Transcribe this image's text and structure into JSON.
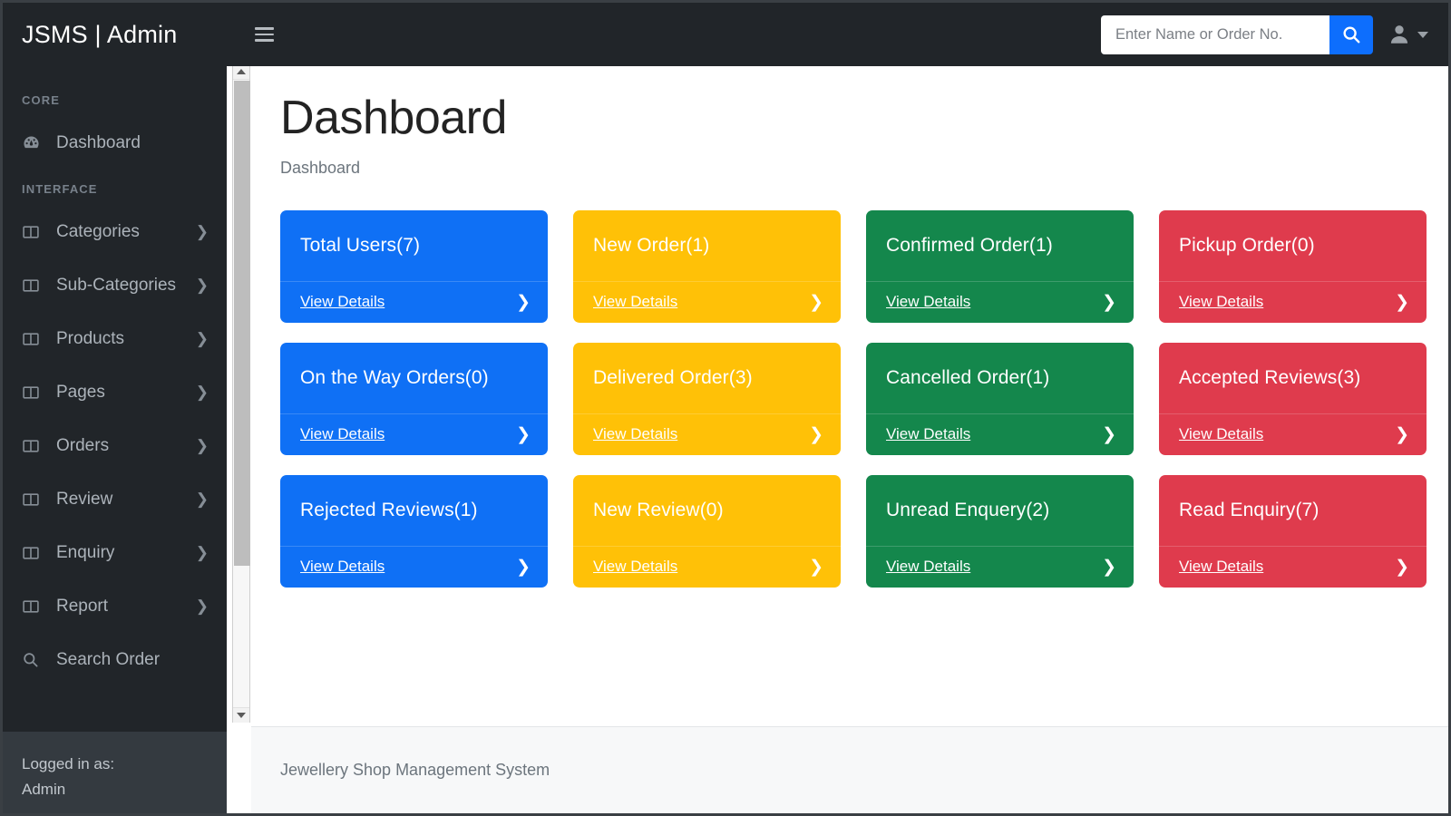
{
  "window": {
    "border_color": "#3a3f44"
  },
  "navbar": {
    "brand": "JSMS | Admin",
    "hamburger_icon": "hamburger-menu-icon",
    "search": {
      "placeholder": "Enter Name or Order No.",
      "value": "",
      "button_icon": "search-icon",
      "button_color": "#0d6efd"
    },
    "user": {
      "icon": "user-avatar-icon",
      "caret_icon": "chevron-down-icon"
    }
  },
  "sidebar": {
    "sections": [
      {
        "heading": "CORE",
        "items": [
          {
            "label": "Dashboard",
            "icon": "tachometer-icon",
            "has_chevron": false
          }
        ]
      },
      {
        "heading": "INTERFACE",
        "items": [
          {
            "label": "Categories",
            "icon": "columns-icon",
            "has_chevron": true
          },
          {
            "label": "Sub-Categories",
            "icon": "columns-icon",
            "has_chevron": true
          },
          {
            "label": "Products",
            "icon": "columns-icon",
            "has_chevron": true
          },
          {
            "label": "Pages",
            "icon": "columns-icon",
            "has_chevron": true
          },
          {
            "label": "Orders",
            "icon": "columns-icon",
            "has_chevron": true
          },
          {
            "label": "Review",
            "icon": "columns-icon",
            "has_chevron": true
          },
          {
            "label": "Enquiry",
            "icon": "columns-icon",
            "has_chevron": true
          },
          {
            "label": "Report",
            "icon": "columns-icon",
            "has_chevron": true
          },
          {
            "label": "Search Order",
            "icon": "search-icon",
            "has_chevron": false
          }
        ]
      }
    ],
    "footer": {
      "label": "Logged in as:",
      "user": "Admin"
    }
  },
  "scrollbar": {
    "up_arrow_icon": "triangle-up-icon",
    "down_arrow_icon": "triangle-down-icon"
  },
  "main": {
    "title": "Dashboard",
    "breadcrumb": "Dashboard",
    "view_details_label": "View Details",
    "chevron_icon": "chevron-right-icon",
    "cards": [
      {
        "title": "Total Users(7)",
        "color": "#0f70f5",
        "variant": "c-blue"
      },
      {
        "title": "New Order(1)",
        "color": "#ffc107",
        "variant": "c-yellow"
      },
      {
        "title": "Confirmed Order(1)",
        "color": "#14874c",
        "variant": "c-green"
      },
      {
        "title": "Pickup Order(0)",
        "color": "#df3b4d",
        "variant": "c-red"
      },
      {
        "title": "On the Way Orders(0)",
        "color": "#0f70f5",
        "variant": "c-blue"
      },
      {
        "title": "Delivered Order(3)",
        "color": "#ffc107",
        "variant": "c-yellow"
      },
      {
        "title": "Cancelled Order(1)",
        "color": "#14874c",
        "variant": "c-green"
      },
      {
        "title": "Accepted Reviews(3)",
        "color": "#df3b4d",
        "variant": "c-red"
      },
      {
        "title": "Rejected Reviews(1)",
        "color": "#0f70f5",
        "variant": "c-blue"
      },
      {
        "title": "New Review(0)",
        "color": "#ffc107",
        "variant": "c-yellow"
      },
      {
        "title": "Unread Enquery(2)",
        "color": "#14874c",
        "variant": "c-green"
      },
      {
        "title": "Read Enquiry(7)",
        "color": "#df3b4d",
        "variant": "c-red"
      }
    ]
  },
  "footer": {
    "text": "Jewellery Shop Management System"
  }
}
